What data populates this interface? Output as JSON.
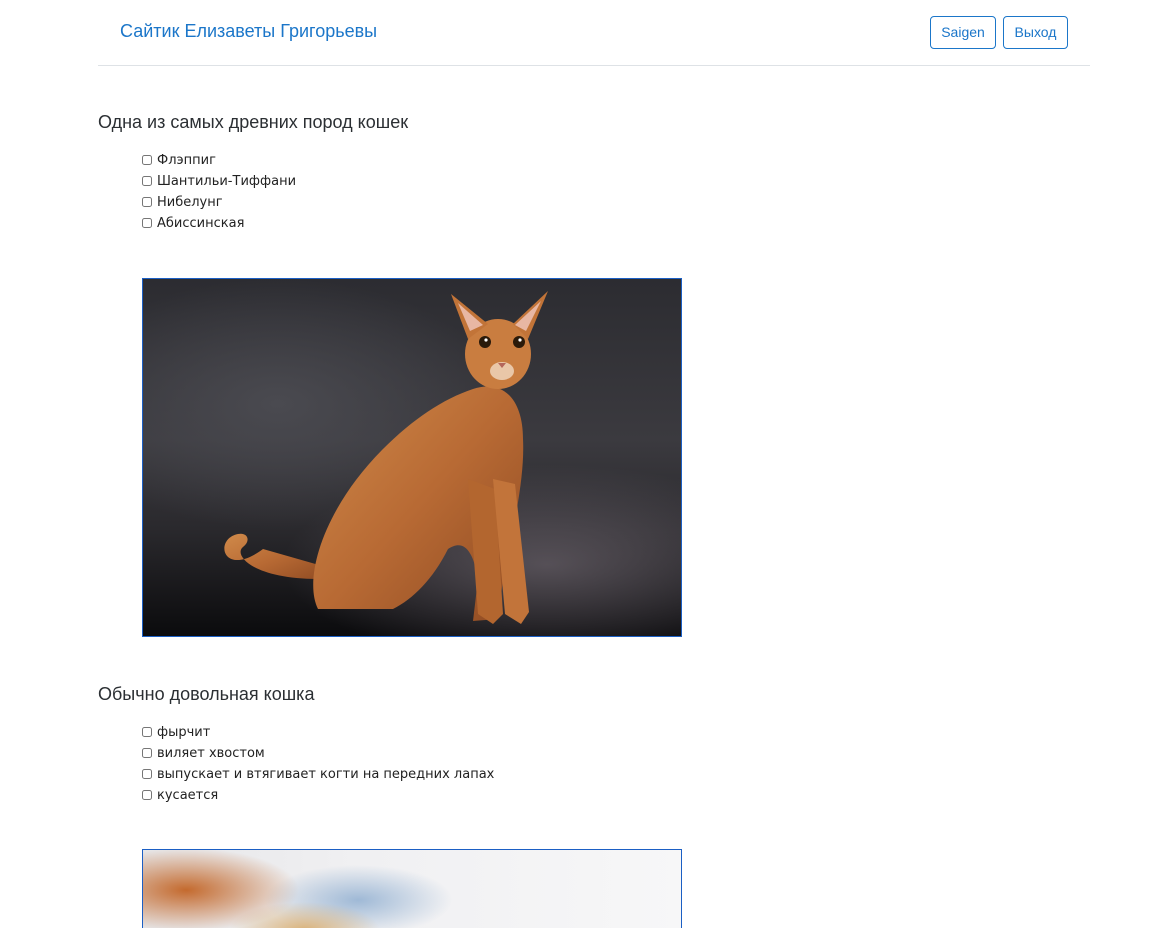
{
  "header": {
    "brand": "Сайтик Елизаветы Григорьевы",
    "user_button": "Saigen",
    "exit_button": "Выход"
  },
  "questions": [
    {
      "text": "Одна из самых древних пород кошек",
      "options": [
        "Флэппиг",
        "Шантильи-Тиффани",
        "Нибелунг",
        "Абиссинская"
      ]
    },
    {
      "text": "Обычно довольная кошка",
      "options": [
        "фырчит",
        "виляет хвостом",
        "выпускает и втягивает когти на передних лапах",
        "кусается"
      ]
    }
  ],
  "colors": {
    "accent": "#1b76c9",
    "divider": "#dee2e6"
  }
}
